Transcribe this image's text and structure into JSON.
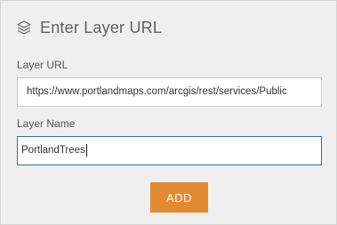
{
  "dialog": {
    "title": "Enter Layer URL",
    "header_icon": "layers-icon"
  },
  "layer_url": {
    "label": "Layer URL",
    "value": "https://www.portlandmaps.com/arcgis/rest/services/Public"
  },
  "layer_name": {
    "label": "Layer Name",
    "value": "PortlandTrees"
  },
  "actions": {
    "add_label": "ADD"
  },
  "colors": {
    "panel_background": "#efefef",
    "add_button": "#e3892f",
    "focused_border": "#3a6fa0",
    "title_text": "#5f5f5f"
  }
}
